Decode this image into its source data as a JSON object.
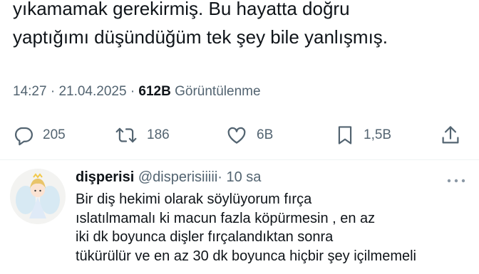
{
  "tweet": {
    "text": "yıkamamak gerekirmiş. Bu hayatta doğru\nyaptığımı düşündüğüm tek şey bile yanlışmış.",
    "time": "14:27",
    "sep": "·",
    "date": "21.04.2025",
    "views_count": "612B",
    "views_label": "Görüntülenme"
  },
  "actions": [
    {
      "icon": "reply-icon",
      "count": "205"
    },
    {
      "icon": "retweet-icon",
      "count": "186"
    },
    {
      "icon": "like-icon",
      "count": "6B"
    },
    {
      "icon": "bookmark-icon",
      "count": "1,5B"
    },
    {
      "icon": "share-icon",
      "count": ""
    }
  ],
  "reply": {
    "name": "dişperisi",
    "handle": "@disperisiiiii",
    "dot": "·",
    "time": "10 sa",
    "text": "Bir diş hekimi olarak söylüyorum fırça\nıslatılmamalı ki macun fazla köpürmesin , en az\niki dk boyunca dişler fırçalandıktan sonra\ntükürülür ve en az 30 dk boyunca hiçbir şey içilmemeli"
  },
  "colors": {
    "secondary_text": "#536471",
    "primary_text": "#0f1419",
    "divider": "#eff3f4"
  }
}
